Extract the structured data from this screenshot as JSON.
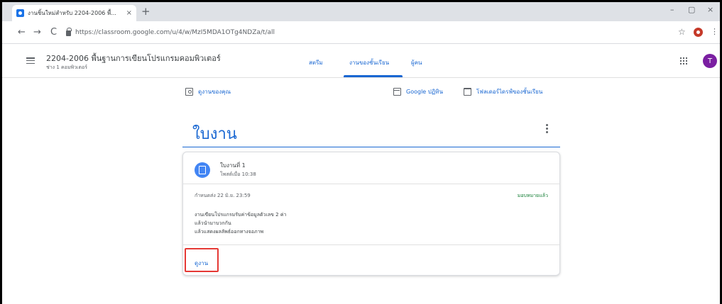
{
  "browser": {
    "tab_title": "งานชิ้นใหม่สำหรับ 2204-2006 พื้...",
    "tab_close": "×",
    "new_tab": "+",
    "url": "https://classroom.google.com/u/4/w/MzI5MDA1OTg4NDZa/t/all",
    "back": "←",
    "forward": "→",
    "reload": "C",
    "star": "☆",
    "menu": "⋮",
    "minimize": "–",
    "restore": "▢",
    "close": "×"
  },
  "header": {
    "course_title": "2204-2006 พื้นฐานการเขียนโปรแกรมคอมพิวเตอร์",
    "course_subtitle": "ช่าง 1 คอมพิวเตอร์",
    "tabs": [
      {
        "label": "สตรีม"
      },
      {
        "label": "งานของชั้นเรียน"
      },
      {
        "label": "ผู้คน"
      }
    ],
    "avatar_initial": "T"
  },
  "classwork": {
    "your_work": "ดูงานของคุณ",
    "calendar": "Google ปฏิทิน",
    "drive_folder": "โฟลเดอร์ไดรฟ์ของชั้นเรียน"
  },
  "topic": {
    "title": "ใบงาน"
  },
  "assignment": {
    "title": "ใบงานที่ 1",
    "meta": "โพสต์เมื่อ 10:38",
    "due": "กำหนดส่ง 22 มิ.ย. 23:59",
    "status": "มอบหมายแล้ว",
    "description_lines": [
      "งานเขียนโปรแกรมรับค่าข้อมูลตัวเลข 2 ค่า",
      "แล้วนำมาบวกกัน",
      "แล้วแสดงผลลัพธ์ออกทางจอภาพ"
    ],
    "view_label": "ดูงาน"
  }
}
